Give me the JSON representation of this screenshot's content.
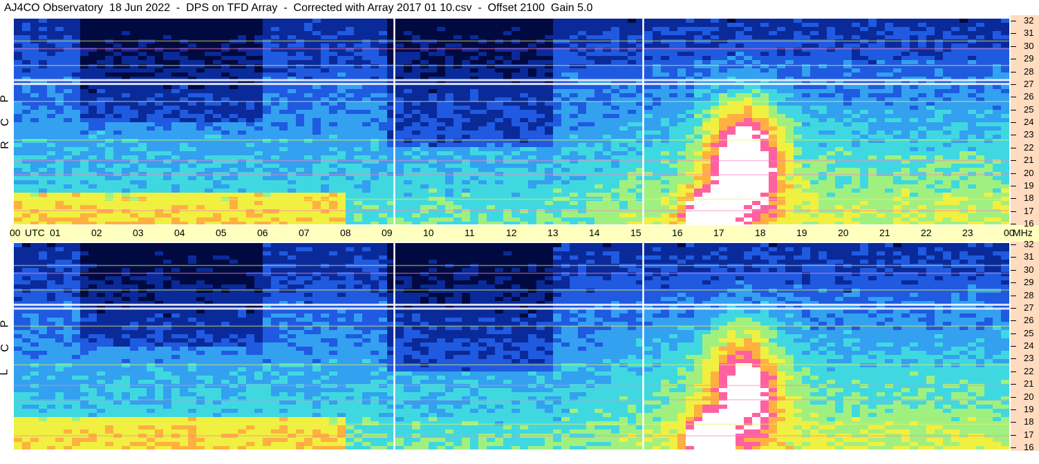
{
  "title": "AJ4CO Observatory  18 Jun 2022  -  DPS on TFD Array  -  Corrected with Array 2017 01 10.csv  -  Offset 2100  Gain 5.0",
  "chart_data": {
    "type": "heatmap",
    "panels": [
      {
        "name": "RCP",
        "label_letters": [
          "P",
          "C",
          "R"
        ]
      },
      {
        "name": "LCP",
        "label_letters": [
          "P",
          "C",
          "L"
        ]
      }
    ],
    "x_ticks": [
      "00",
      "UTC",
      "01",
      "02",
      "03",
      "04",
      "05",
      "06",
      "07",
      "08",
      "09",
      "10",
      "11",
      "12",
      "13",
      "14",
      "15",
      "16",
      "17",
      "18",
      "19",
      "20",
      "21",
      "22",
      "23",
      "00",
      "MHz"
    ],
    "x_range_hours": [
      0,
      24
    ],
    "y_ticks": [
      "32",
      "31",
      "30",
      "29",
      "28",
      "27",
      "26",
      "25",
      "24",
      "23",
      "22",
      "21",
      "20",
      "19",
      "18",
      "17",
      "16"
    ],
    "y_range_mhz": [
      16,
      32
    ],
    "vertical_markers_utc_hours": [
      9.17,
      15.17
    ],
    "colormap": [
      "#000a40",
      "#0a2a9a",
      "#1f5ae0",
      "#33a0f0",
      "#40d8e0",
      "#a0f080",
      "#f0f040",
      "#ffb040",
      "#ff60a0",
      "#ffffff"
    ]
  }
}
